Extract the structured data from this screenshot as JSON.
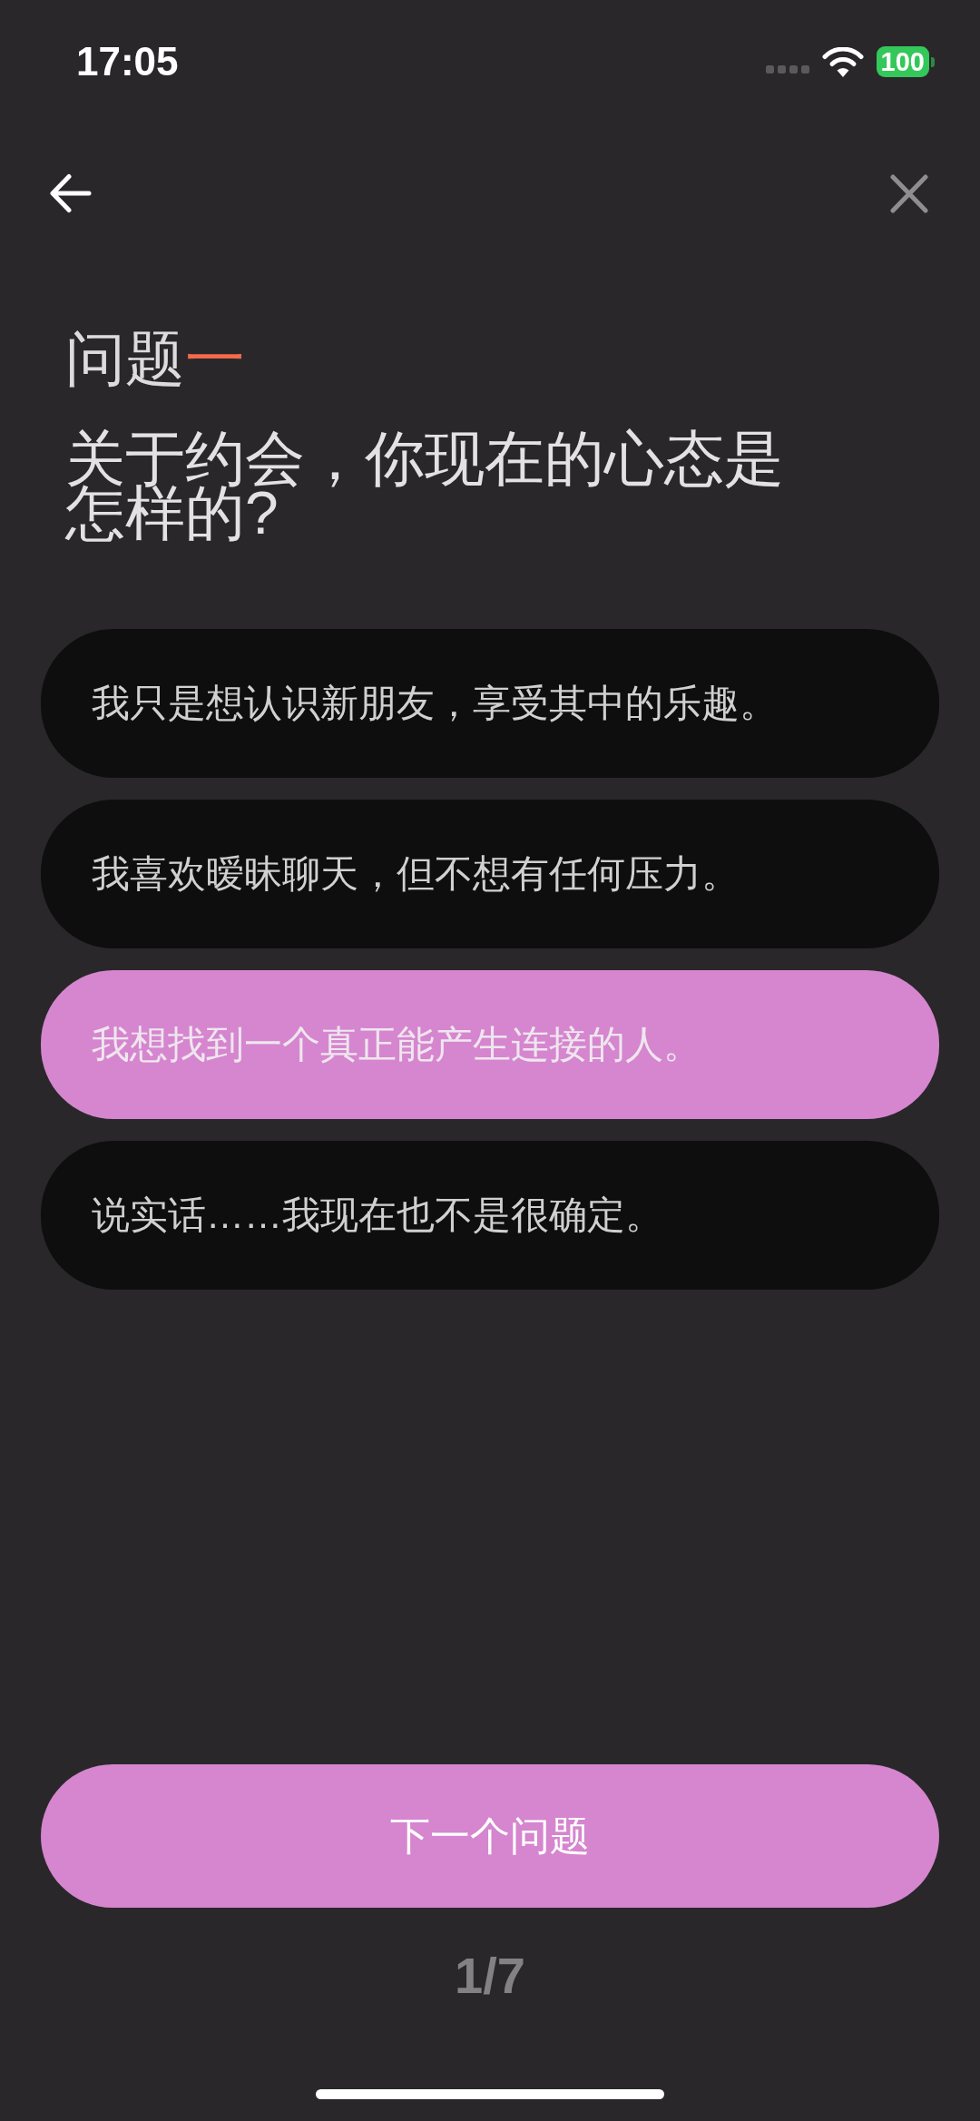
{
  "status_bar": {
    "time": "17:05",
    "battery": "100"
  },
  "question": {
    "label": "问题",
    "number": "一",
    "text": "关于约会，你现在的心态是怎样的?"
  },
  "options": [
    {
      "text": "我只是想认识新朋友，享受其中的乐趣。",
      "selected": false
    },
    {
      "text": "我喜欢暧昧聊天，但不想有任何压力。",
      "selected": false
    },
    {
      "text": "我想找到一个真正能产生连接的人。",
      "selected": true
    },
    {
      "text": "说实话……我现在也不是很确定。",
      "selected": false
    }
  ],
  "next_button": {
    "label": "下一个问题"
  },
  "progress": {
    "text": "1/7"
  }
}
